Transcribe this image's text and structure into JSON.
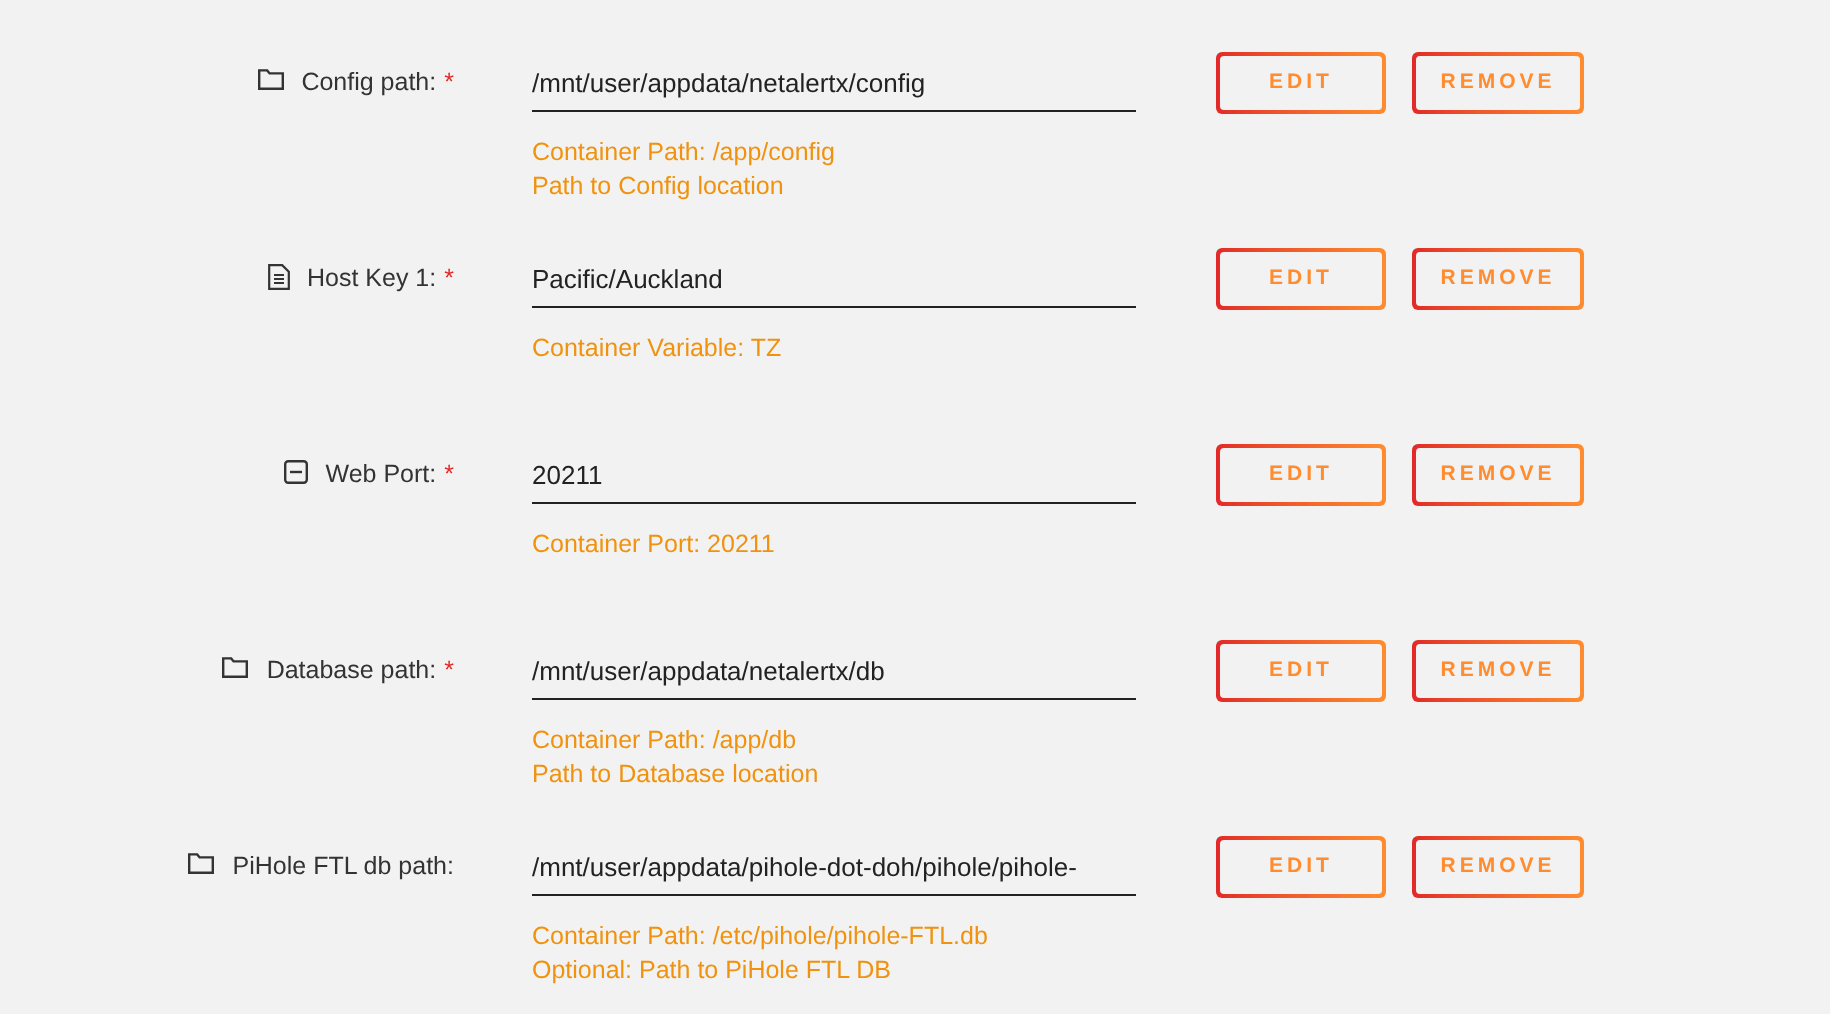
{
  "rows": [
    {
      "kind": "path",
      "label": "Config path:",
      "required_mark": "*",
      "value": "/mnt/user/appdata/netalertx/config",
      "notes": [
        "Container Path: /app/config",
        "Path to Config location"
      ],
      "buttons": [
        "EDIT",
        "REMOVE"
      ]
    },
    {
      "kind": "variable",
      "label": "Host Key 1:",
      "required_mark": "*",
      "value": "Pacific/Auckland",
      "notes": [
        "Container Variable: TZ"
      ],
      "buttons": [
        "EDIT",
        "REMOVE"
      ]
    },
    {
      "kind": "port",
      "label": "Web Port:",
      "required_mark": "*",
      "value": "20211",
      "notes": [
        "Container Port: 20211"
      ],
      "buttons": [
        "EDIT",
        "REMOVE"
      ]
    },
    {
      "kind": "path",
      "label": "Database path:",
      "required_mark": "*",
      "value": "/mnt/user/appdata/netalertx/db",
      "notes": [
        "Container Path: /app/db",
        "Path to Database location"
      ],
      "buttons": [
        "EDIT",
        "REMOVE"
      ]
    },
    {
      "kind": "path",
      "label": "PiHole FTL db path:",
      "value": "/mnt/user/appdata/pihole-dot-doh/pihole/pihole-",
      "notes": [
        "Container Path: /etc/pihole/pihole-FTL.db",
        "Optional: Path to PiHole FTL DB"
      ],
      "buttons": [
        "EDIT",
        "REMOVE"
      ]
    }
  ]
}
